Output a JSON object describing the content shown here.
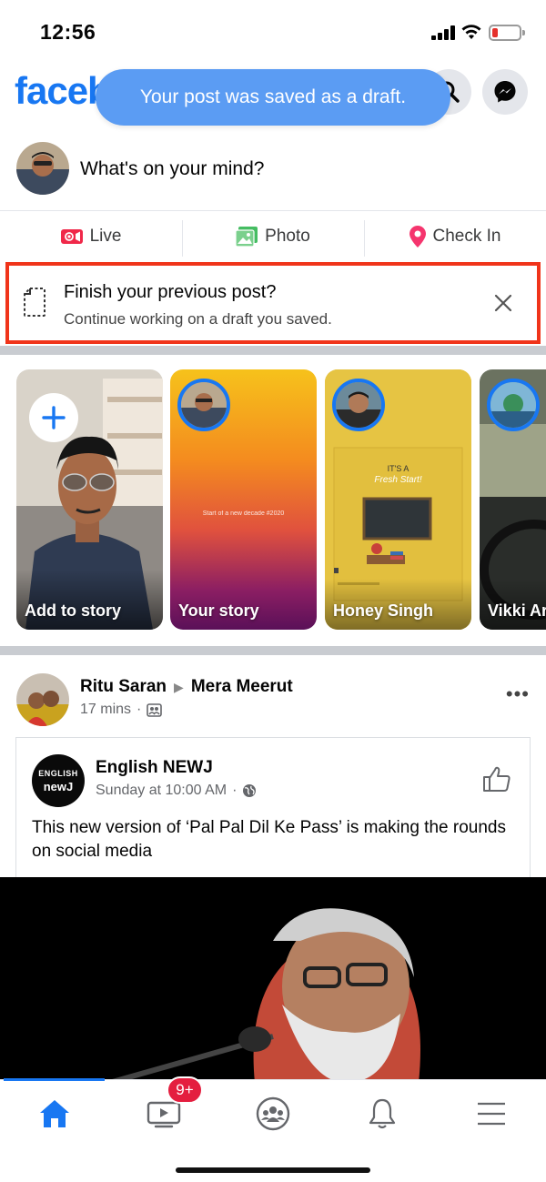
{
  "status_bar": {
    "time": "12:56"
  },
  "header": {
    "logo_text": "facebook",
    "brand_color": "#1877f2"
  },
  "toast": {
    "message": "Your post was saved as a draft."
  },
  "composer": {
    "placeholder": "What's on your mind?"
  },
  "actions": [
    {
      "label": "Live",
      "icon": "live-video-icon"
    },
    {
      "label": "Photo",
      "icon": "photo-icon"
    },
    {
      "label": "Check In",
      "icon": "location-pin-icon"
    }
  ],
  "draft_banner": {
    "title": "Finish your previous post?",
    "subtitle": "Continue working on a draft you saved.",
    "border_color": "#f0341a"
  },
  "stories": [
    {
      "label": "Add to story"
    },
    {
      "label": "Your story",
      "caption": "Start of a new decade #2020"
    },
    {
      "label": "Honey Singh",
      "caption_line1": "IT'S A",
      "caption_line2": "Fresh Start!"
    },
    {
      "label": "Vikki Ar"
    }
  ],
  "post": {
    "author": "Ritu Saran",
    "group": "Mera Meerut",
    "time": "17 mins",
    "shared": {
      "page_avatar_line1": "ENGLISH",
      "page_avatar_line2": "newJ",
      "page_name": "English NEWJ",
      "time": "Sunday at 10:00 AM",
      "text": "This new version of ‘Pal Pal Dil Ke Pass’ is making the rounds on social media"
    }
  },
  "tabbar": {
    "watch_badge": "9+",
    "active_tab": "home"
  }
}
